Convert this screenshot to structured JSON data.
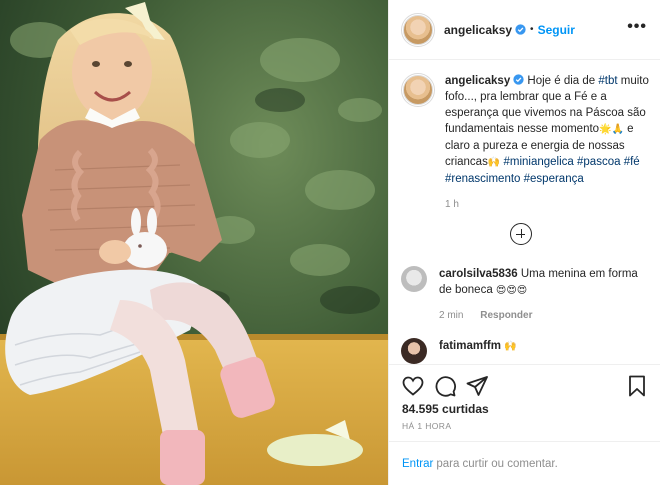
{
  "header": {
    "username": "angelicaksy",
    "separator": "•",
    "follow_label": "Seguir",
    "more_label": "•••"
  },
  "caption": {
    "username": "angelicaksy",
    "text_before": " Hoje é dia de ",
    "tag_tbt": "#tbt",
    "text_mid": " muito fofo..., pra lembrar que a Fé e a esperança que vivemos na Páscoa são fundamentais nesse momento",
    "emoji_mid": "🌟🙏",
    "text_after": " e claro a pureza e energia de nossas criancas",
    "emoji_end": "🙌",
    "tags": [
      "#miniangelica",
      "#pascoa",
      "#fé",
      "#renascimento",
      "#esperança"
    ],
    "time": "1 h"
  },
  "comments": [
    {
      "username": "carolsilva5836",
      "text": " Uma menina em forma de boneca ",
      "emoji": "😍😍😍",
      "time": "2 min",
      "reply_label": "Responder"
    },
    {
      "username": "fatimamffm",
      "emoji": "🙌"
    }
  ],
  "stats": {
    "likes": "84.595 curtidas",
    "posted": "HÁ 1 HORA"
  },
  "add_comment": {
    "enter_label": "Entrar",
    "rest_label": "para curtir ou comentar."
  },
  "icons": [
    "verified-icon",
    "more-icon",
    "expand-comments-icon",
    "heart-icon",
    "comment-icon",
    "share-icon",
    "bookmark-icon"
  ],
  "colors": {
    "link_blue": "#0095f6",
    "hashtag": "#00376b",
    "muted": "#8e8e8e",
    "text": "#262626"
  }
}
